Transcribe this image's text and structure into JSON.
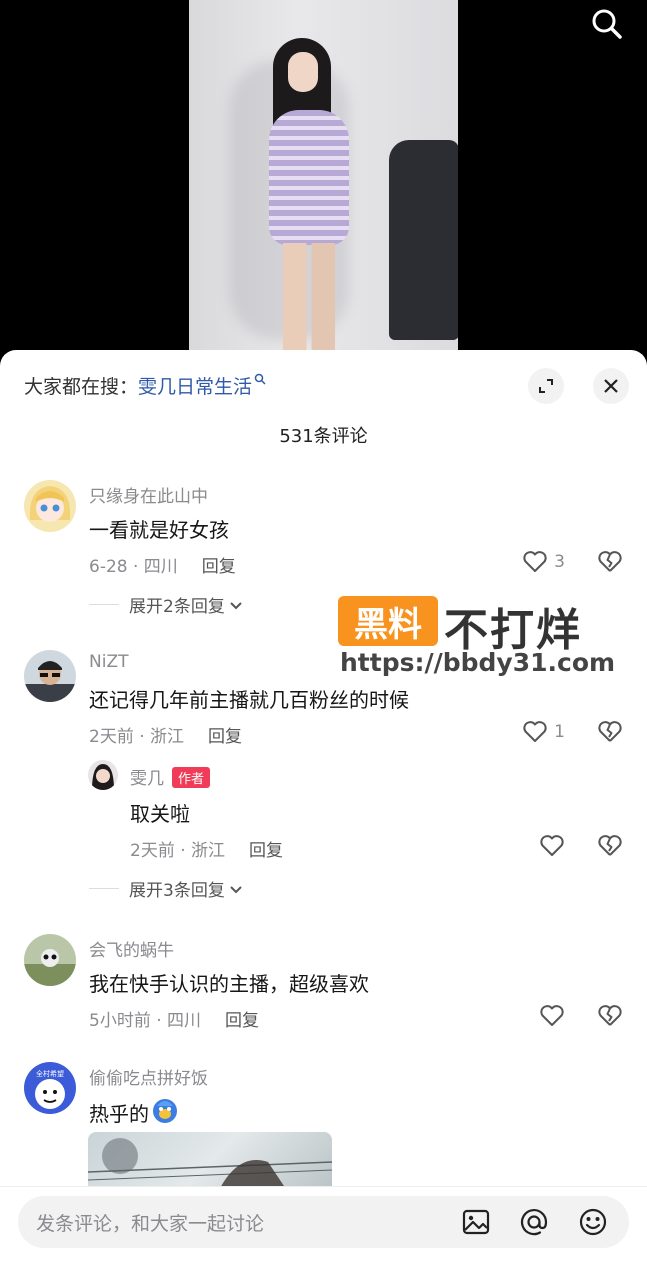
{
  "header": {
    "trending_prefix": "大家都在搜：",
    "trending_keyword": "雯几日常生活"
  },
  "comments_count": "531条评论",
  "comments": [
    {
      "username": "只缘身在此山中",
      "text": "一看就是好女孩",
      "time_location": "6-28 · 四川",
      "reply_label": "回复",
      "likes": "3",
      "expand_label": "展开2条回复"
    },
    {
      "username": "NiZT",
      "text": "还记得几年前主播就几百粉丝的时候",
      "time_location": "2天前 · 浙江",
      "reply_label": "回复",
      "likes": "1",
      "reply": {
        "username": "雯几",
        "badge": "作者",
        "text": "取关啦",
        "time_location": "2天前 · 浙江",
        "reply_label": "回复"
      },
      "expand_label": "展开3条回复"
    },
    {
      "username": "会飞的蜗牛",
      "text": "我在快手认识的主播，超级喜欢",
      "time_location": "5小时前 · 四川",
      "reply_label": "回复"
    },
    {
      "username": "偷偷吃点拼好饭",
      "text": "热乎的",
      "avatar_text": "全村希望"
    }
  ],
  "watermark": {
    "badge": "黑料",
    "title": "不打烊",
    "url": "https://bbdy31.com"
  },
  "input": {
    "placeholder": "发条评论，和大家一起讨论"
  },
  "colors": {
    "keyword": "#2f5aa8",
    "author_badge": "#f03c58",
    "watermark_orange": "#f7931e"
  }
}
